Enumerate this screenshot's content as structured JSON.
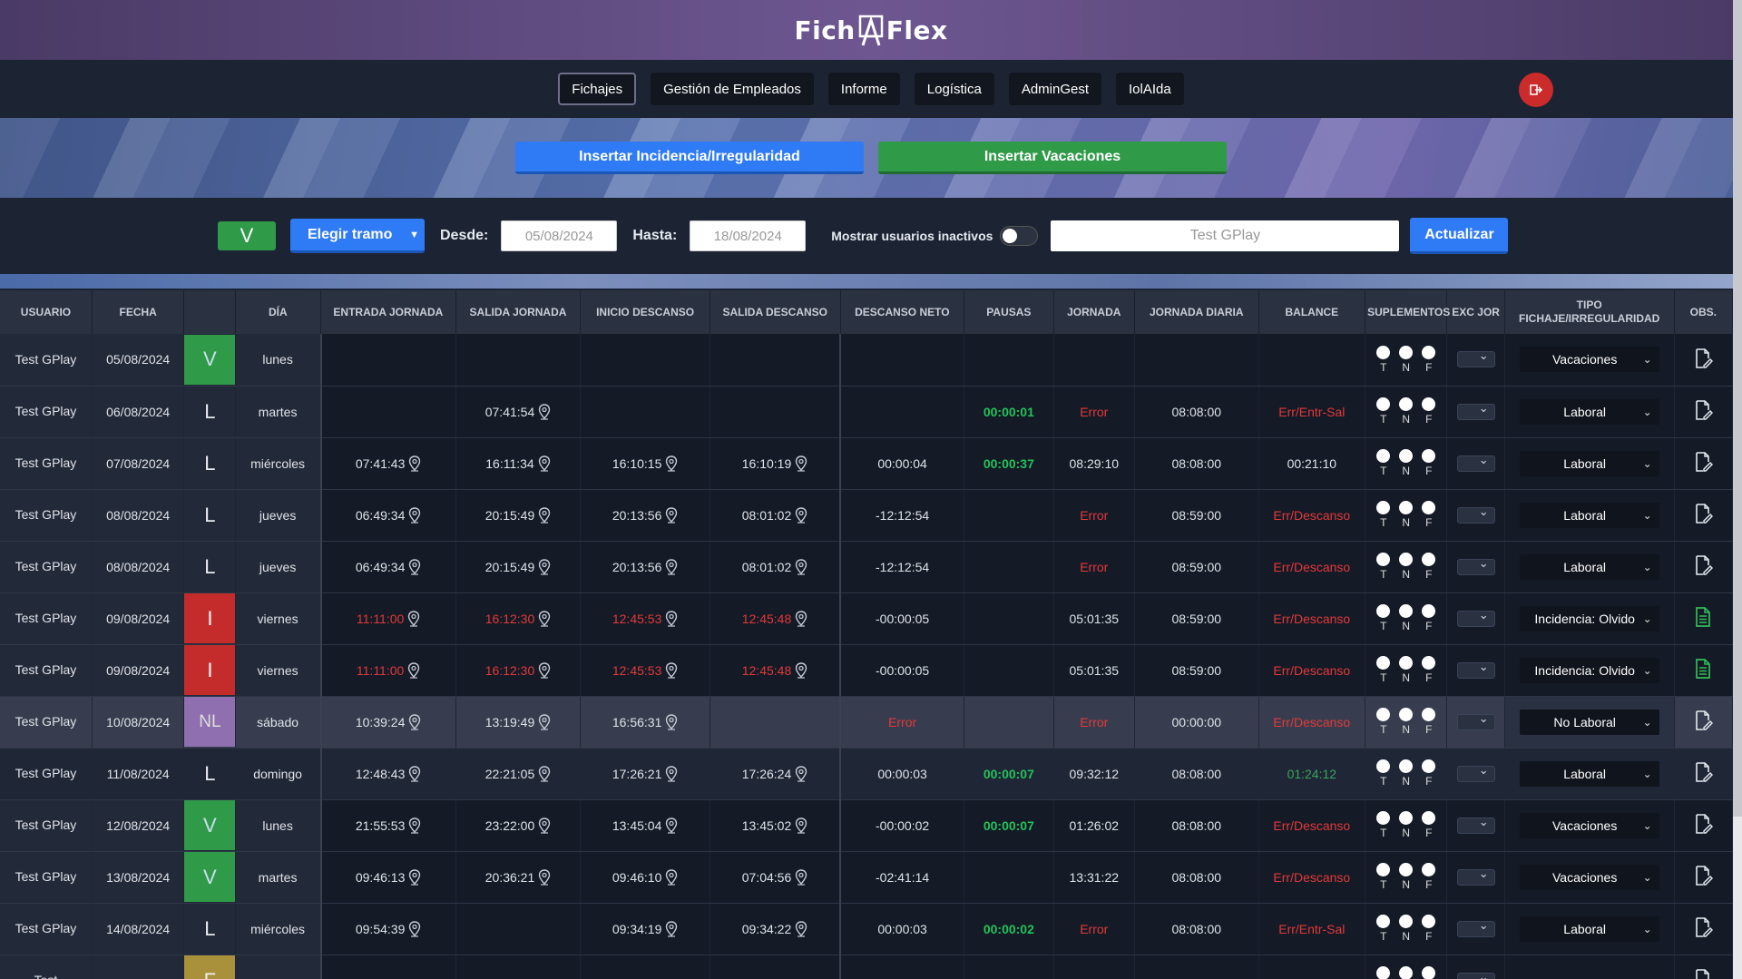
{
  "header": {
    "logo_left": "Fich",
    "logo_right": "Flex"
  },
  "nav": {
    "items": [
      "Fichajes",
      "Gestión de Empleados",
      "Informe",
      "Logística",
      "AdminGest",
      "IolAIda"
    ],
    "active": "Fichajes"
  },
  "banner": {
    "incidencia_label": "Insertar Incidencia/Irregularidad",
    "vacaciones_label": "Insertar Vacaciones"
  },
  "filters": {
    "badge": "V",
    "tramo_label": "Elegir tramo",
    "desde_label": "Desde:",
    "desde_value": "05/08/2024",
    "hasta_label": "Hasta:",
    "hasta_value": "18/08/2024",
    "inactivos_label": "Mostrar usuarios inactivos",
    "user_value": "Test GPlay",
    "update_label": "Actualizar"
  },
  "table": {
    "headers": [
      "USUARIO",
      "FECHA",
      "",
      "DÍA",
      "ENTRADA JORNADA",
      "SALIDA JORNADA",
      "INICIO DESCANSO",
      "SALIDA DESCANSO",
      "DESCANSO NETO",
      "PAUSAS",
      "JORNADA",
      "JORNADA DIARIA",
      "BALANCE",
      "SUPLEMENTOS",
      "EXC JOR",
      "TIPO FICHAJE/IRREGULARIDAD",
      "OBS."
    ],
    "sup_labels": [
      "T",
      "N",
      "F"
    ],
    "rows": [
      {
        "user": "Test GPlay",
        "fecha": "05/08/2024",
        "badge": "V",
        "dia": "lunes",
        "entrada": "",
        "salida": "",
        "inicio": "",
        "salida_desc": "",
        "neto": "",
        "pausas": "",
        "jornada": "",
        "diaria": "",
        "balance": "",
        "tipo": "Vacaciones",
        "obs": "edit"
      },
      {
        "user": "Test GPlay",
        "fecha": "06/08/2024",
        "badge": "L",
        "dia": "martes",
        "entrada": "",
        "salida": "07:41:54",
        "inicio": "",
        "salida_desc": "",
        "neto": "",
        "pausas": "00:00:01",
        "jornada": "Error",
        "diaria": "08:08:00",
        "balance": "Err/Entr-Sal",
        "tipo": "Laboral",
        "obs": "edit"
      },
      {
        "user": "Test GPlay",
        "fecha": "07/08/2024",
        "badge": "L",
        "dia": "miércoles",
        "entrada": "07:41:43",
        "salida": "16:11:34",
        "inicio": "16:10:15",
        "salida_desc": "16:10:19",
        "neto": "00:00:04",
        "pausas": "00:00:37",
        "jornada": "08:29:10",
        "diaria": "08:08:00",
        "balance": "00:21:10",
        "tipo": "Laboral",
        "obs": "edit"
      },
      {
        "user": "Test GPlay",
        "fecha": "08/08/2024",
        "badge": "L",
        "dia": "jueves",
        "entrada": "06:49:34",
        "salida": "20:15:49",
        "inicio": "20:13:56",
        "salida_desc": "08:01:02",
        "neto": "-12:12:54",
        "pausas": "",
        "jornada": "Error",
        "diaria": "08:59:00",
        "balance": "Err/Descanso",
        "tipo": "Laboral",
        "obs": "edit"
      },
      {
        "user": "Test GPlay",
        "fecha": "08/08/2024",
        "badge": "L",
        "dia": "jueves",
        "entrada": "06:49:34",
        "salida": "20:15:49",
        "inicio": "20:13:56",
        "salida_desc": "08:01:02",
        "neto": "-12:12:54",
        "pausas": "",
        "jornada": "Error",
        "diaria": "08:59:00",
        "balance": "Err/Descanso",
        "tipo": "Laboral",
        "obs": "edit"
      },
      {
        "user": "Test GPlay",
        "fecha": "09/08/2024",
        "badge": "I",
        "dia": "viernes",
        "entrada": "11:11:00",
        "salida": "16:12:30",
        "inicio": "12:45:53",
        "salida_desc": "12:45:48",
        "neto": "-00:00:05",
        "pausas": "",
        "jornada": "05:01:35",
        "diaria": "08:59:00",
        "balance": "Err/Descanso",
        "tipo": "Incidencia: Olvido",
        "obs": "doc"
      },
      {
        "user": "Test GPlay",
        "fecha": "09/08/2024",
        "badge": "I",
        "dia": "viernes",
        "entrada": "11:11:00",
        "salida": "16:12:30",
        "inicio": "12:45:53",
        "salida_desc": "12:45:48",
        "neto": "-00:00:05",
        "pausas": "",
        "jornada": "05:01:35",
        "diaria": "08:59:00",
        "balance": "Err/Descanso",
        "tipo": "Incidencia: Olvido",
        "obs": "doc"
      },
      {
        "user": "Test GPlay",
        "fecha": "10/08/2024",
        "badge": "NL",
        "dia": "sábado",
        "entrada": "10:39:24",
        "salida": "13:19:49",
        "inicio": "16:56:31",
        "salida_desc": "",
        "neto": "Error",
        "pausas": "",
        "jornada": "Error",
        "diaria": "00:00:00",
        "balance": "Err/Descanso",
        "tipo": "No Laboral",
        "obs": "edit"
      },
      {
        "user": "Test GPlay",
        "fecha": "11/08/2024",
        "badge": "L",
        "dia": "domingo",
        "entrada": "12:48:43",
        "salida": "22:21:05",
        "inicio": "17:26:21",
        "salida_desc": "17:26:24",
        "neto": "00:00:03",
        "pausas": "00:00:07",
        "jornada": "09:32:12",
        "diaria": "08:08:00",
        "balance": "01:24:12",
        "tipo": "Laboral",
        "obs": "edit"
      },
      {
        "user": "Test GPlay",
        "fecha": "12/08/2024",
        "badge": "V",
        "dia": "lunes",
        "entrada": "21:55:53",
        "salida": "23:22:00",
        "inicio": "13:45:04",
        "salida_desc": "13:45:02",
        "neto": "-00:00:02",
        "pausas": "00:00:07",
        "jornada": "01:26:02",
        "diaria": "08:08:00",
        "balance": "Err/Descanso",
        "tipo": "Vacaciones",
        "obs": "edit"
      },
      {
        "user": "Test GPlay",
        "fecha": "13/08/2024",
        "badge": "V",
        "dia": "martes",
        "entrada": "09:46:13",
        "salida": "20:36:21",
        "inicio": "09:46:10",
        "salida_desc": "07:04:56",
        "neto": "-02:41:14",
        "pausas": "",
        "jornada": "13:31:22",
        "diaria": "08:08:00",
        "balance": "Err/Descanso",
        "tipo": "Vacaciones",
        "obs": "edit"
      },
      {
        "user": "Test GPlay",
        "fecha": "14/08/2024",
        "badge": "L",
        "dia": "miércoles",
        "entrada": "09:54:39",
        "salida": "",
        "inicio": "09:34:19",
        "salida_desc": "09:34:22",
        "neto": "00:00:03",
        "pausas": "00:00:02",
        "jornada": "Error",
        "diaria": "08:08:00",
        "balance": "Err/Entr-Sal",
        "tipo": "Laboral",
        "obs": "edit"
      },
      {
        "user": "Test",
        "fecha": "",
        "badge": "F",
        "dia": "",
        "entrada": "",
        "salida": "",
        "inicio": "",
        "salida_desc": "",
        "neto": "",
        "pausas": "",
        "jornada": "",
        "diaria": "",
        "balance": "",
        "tipo": "",
        "obs": "edit"
      }
    ]
  },
  "colors": {
    "accent_blue": "#2f7bf5",
    "accent_green": "#2f9b49",
    "error_red": "#e23a3a",
    "logout_red": "#cc2b2b"
  }
}
